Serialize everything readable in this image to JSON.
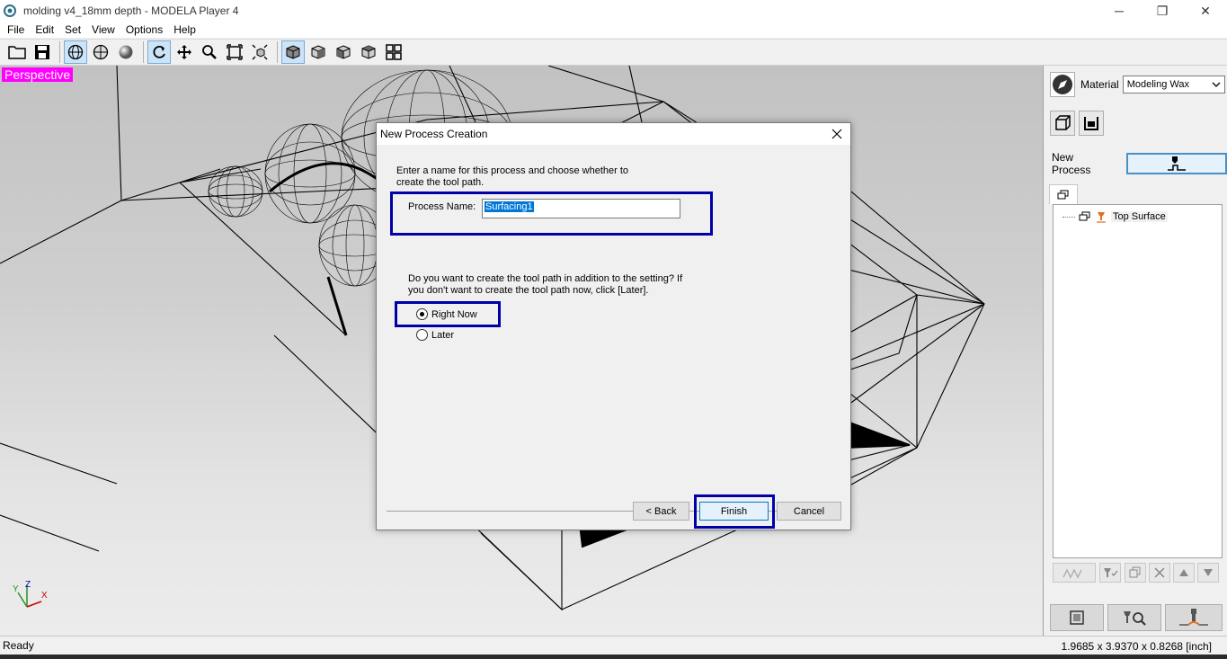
{
  "window": {
    "title": "molding v4_18mm depth  - MODELA Player 4",
    "minimize": "─",
    "restore": "❐",
    "close": "✕"
  },
  "menu": [
    "File",
    "Edit",
    "Set",
    "View",
    "Options",
    "Help"
  ],
  "viewport": {
    "label": "Perspective",
    "axis": {
      "y": "Y",
      "z": "Z",
      "x": "X"
    }
  },
  "dialog": {
    "title": "New Process Creation",
    "intro": "Enter a name for this process and choose whether to create the tool path.",
    "process_name_label": "Process Name:",
    "process_name_value": "Surfacing1",
    "question": "Do you want to create the tool path in addition to the setting? If you don't want to create the tool path now, click [Later].",
    "options": [
      {
        "label": "Right Now",
        "checked": true
      },
      {
        "label": "Later",
        "checked": false
      }
    ],
    "back_label": "< Back",
    "finish_label": "Finish",
    "cancel_label": "Cancel"
  },
  "right_panel": {
    "material_label": "Material",
    "material_value": "Modeling Wax",
    "new_process_label": "New Process",
    "tree_item": "Top Surface"
  },
  "status": {
    "left": "Ready",
    "right": "1.9685 x 3.9370 x 0.8268 [inch]"
  }
}
